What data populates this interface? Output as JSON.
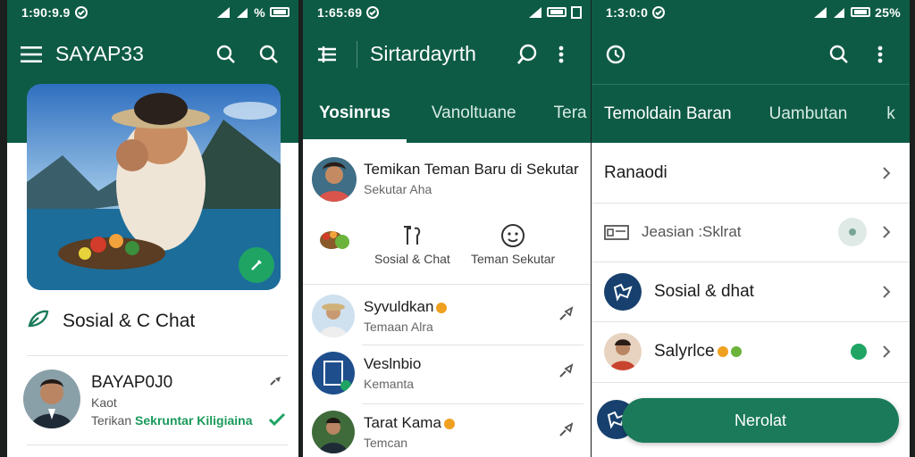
{
  "phone1": {
    "status": {
      "time": "1:90:9.9",
      "battery": "%"
    },
    "appbar": {
      "title": "SAYAP33"
    },
    "section": {
      "title": "Sosial & C Chat"
    },
    "contact": {
      "name": "BAYAP0J0",
      "sub": "Kaot",
      "msg_prefix": "Terikan",
      "msg_highlight": "Sekruntar Kiligiaina"
    }
  },
  "phone2": {
    "status": {
      "time": "1:65:69"
    },
    "appbar": {
      "title": "Sirtardayrth"
    },
    "tabs": [
      "Yosinrus",
      "Vanoltuane",
      "Tera"
    ],
    "top": {
      "title": "Temikan Teman Baru di Sekutar",
      "sub": "Sekutar Aha"
    },
    "features": [
      {
        "label": "Sosial & Chat",
        "icon": "chat-icon"
      },
      {
        "label": "Teman Sekutar",
        "icon": "face-icon"
      }
    ],
    "chats": [
      {
        "name": "Syvuldkan",
        "sub": "Temaan Alra"
      },
      {
        "name": "Veslnbio",
        "sub": "Kemanta"
      },
      {
        "name": "Tarat Kama",
        "sub": "Temcan"
      }
    ]
  },
  "phone3": {
    "status": {
      "time": "1:3:0:0",
      "battery": "25%"
    },
    "tabs": [
      "Temoldain Baran",
      "Uambutan",
      "k"
    ],
    "rows": [
      {
        "label": "Ranaodi"
      },
      {
        "label": "Jeasian :Sklrat"
      },
      {
        "label": "Sosial & dhat"
      },
      {
        "label": "Salyrlce"
      }
    ],
    "button": {
      "label": "Nerolat"
    }
  },
  "colors": {
    "brand": "#0e5b45",
    "accent": "#1fa464",
    "button": "#1a7a5a"
  }
}
